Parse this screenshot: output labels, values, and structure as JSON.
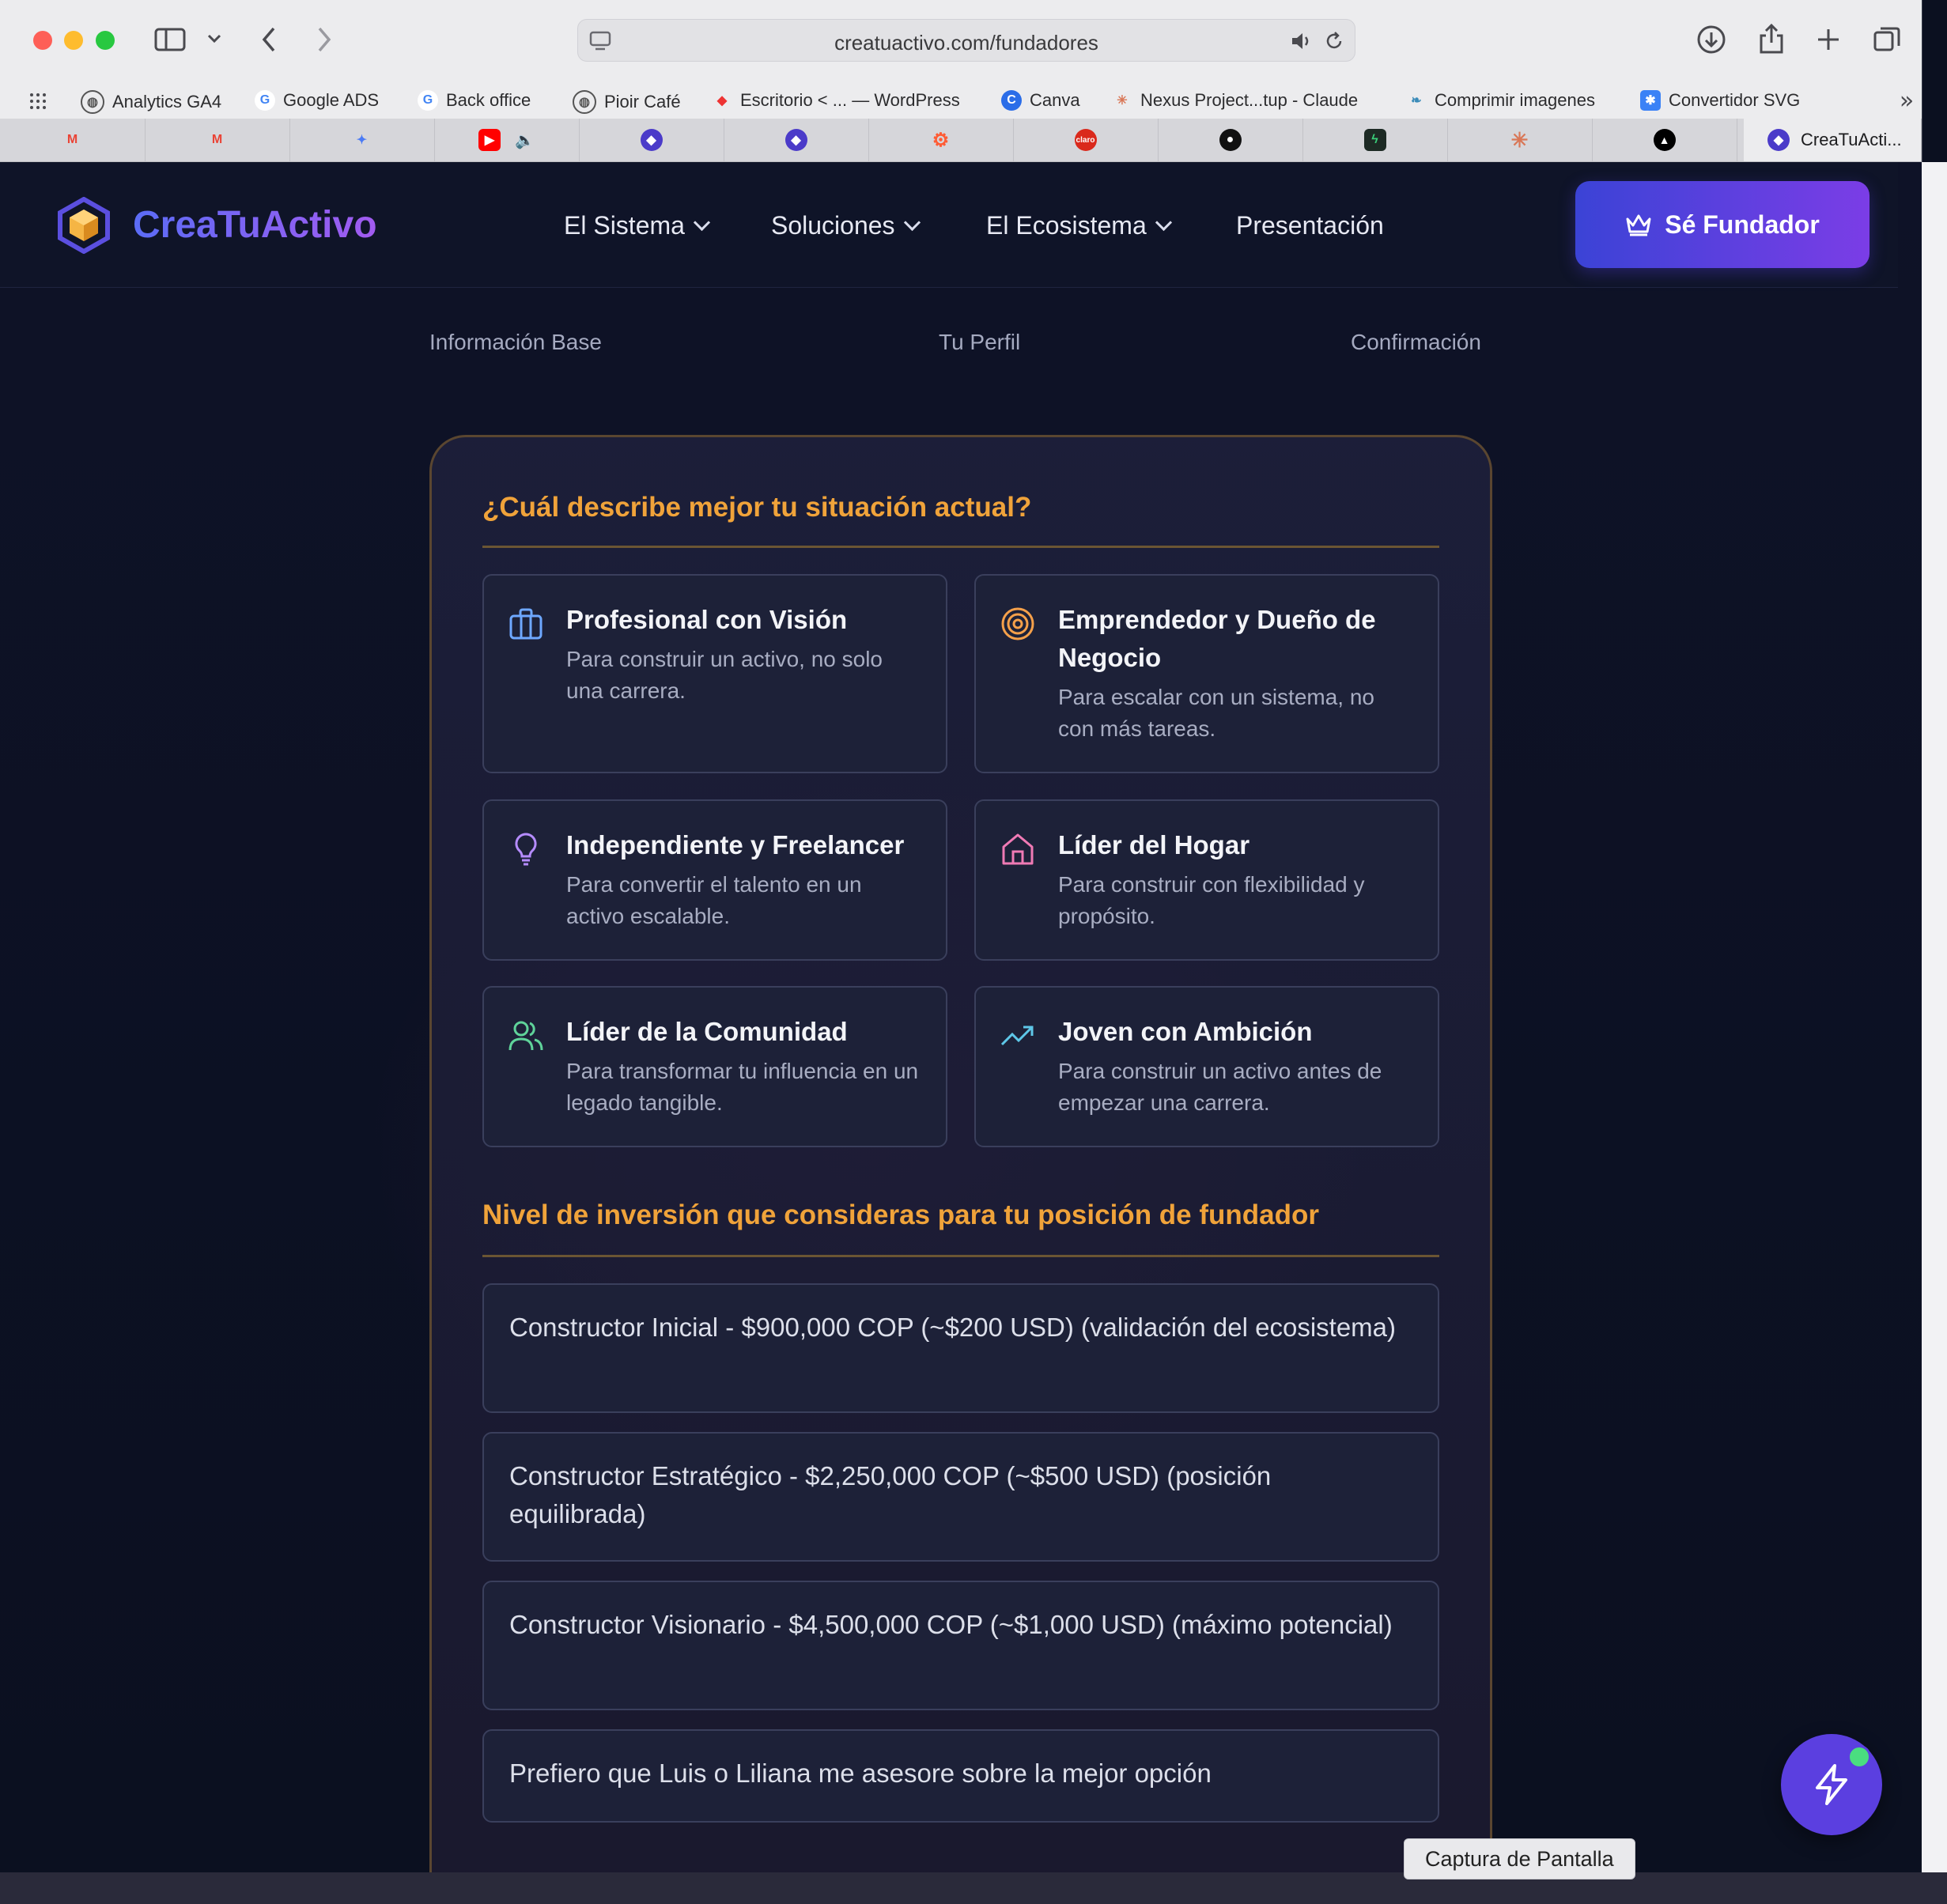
{
  "browser": {
    "url": "creatuactivo.com/fundadores",
    "bookmarks": [
      "Analytics GA4",
      "Google ADS",
      "Back office",
      "Pioir Café",
      "Escritorio < ... — WordPress",
      "Canva",
      "Nexus Project...tup - Claude",
      "Comprimir imagenes",
      "Convertidor SVG"
    ],
    "active_tab": "CreaTuActi..."
  },
  "site": {
    "logo": "CreaTuActivo",
    "nav": [
      "El Sistema",
      "Soluciones",
      "El Ecosistema",
      "Presentación"
    ],
    "cta": "Sé Fundador"
  },
  "steps": [
    "Información Base",
    "Tu Perfil",
    "Confirmación"
  ],
  "situation": {
    "title": "¿Cuál describe mejor tu situación actual?",
    "options": [
      {
        "title": "Profesional con Visión",
        "desc": "Para construir un activo, no solo una carrera.",
        "icon": "briefcase-icon",
        "color": "#6ea8ff"
      },
      {
        "title": "Emprendedor y Dueño de Negocio",
        "desc": "Para escalar con un sistema, no con más tareas.",
        "icon": "target-icon",
        "color": "#f5a04a"
      },
      {
        "title": "Independiente y Freelancer",
        "desc": "Para convertir el talento en un activo escalable.",
        "icon": "lightbulb-icon",
        "color": "#b58cff"
      },
      {
        "title": "Líder del Hogar",
        "desc": "Para construir con flexibilidad y propósito.",
        "icon": "home-icon",
        "color": "#f07ab5"
      },
      {
        "title": "Líder de la Comunidad",
        "desc": "Para transformar tu influencia en un legado tangible.",
        "icon": "users-icon",
        "color": "#5fd39a"
      },
      {
        "title": "Joven con Ambición",
        "desc": "Para construir un activo antes de empezar una carrera.",
        "icon": "trending-up-icon",
        "color": "#5ec7e8"
      }
    ]
  },
  "investment": {
    "title": "Nivel de inversión que consideras para tu posición de fundador",
    "options": [
      "Constructor Inicial - $900,000 COP (~$200 USD) (validación del ecosistema)",
      "Constructor Estratégico - $2,250,000 COP (~$500 USD) (posición equilibrada)",
      "Constructor Visionario - $4,500,000 COP (~$1,000 USD) (máximo potencial)",
      "Prefiero que Luis o Liliana me asesore sobre la mejor opción"
    ]
  },
  "tooltip": "Captura de Pantalla"
}
